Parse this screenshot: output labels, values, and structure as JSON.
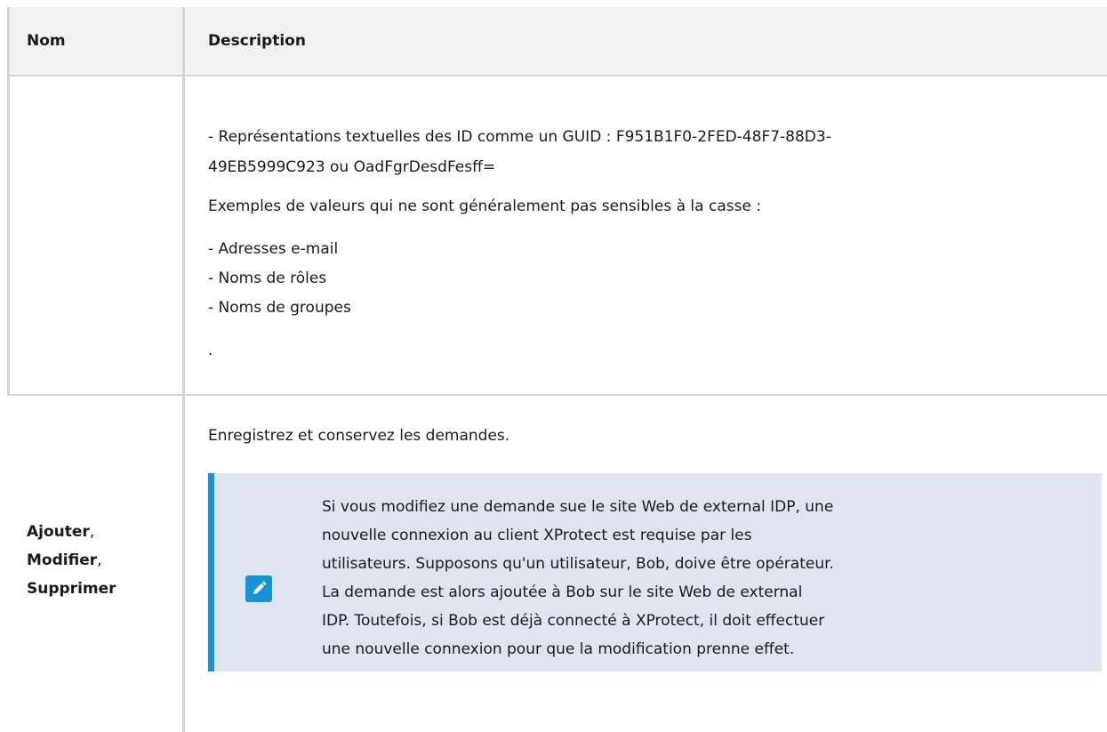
{
  "table": {
    "headers": {
      "name": "Nom",
      "description": "Description"
    },
    "row1": {
      "name": "",
      "lines": [
        "- Représentations textuelles des ID comme un GUID : F951B1F0-2FED-48F7-88D3-",
        "49EB5999C923 ou OadFgrDesdFesff=",
        "Exemples de valeurs qui ne sont généralement pas sensibles à la casse :",
        "- Adresses e-mail",
        "- Noms de rôles",
        "- Noms de groupes",
        "."
      ]
    },
    "row2": {
      "name_parts": {
        "add": "Ajouter",
        "sep1": ",",
        "modify": "Modifier",
        "sep2": ",",
        "delete": "Supprimer"
      },
      "intro": "Enregistrez et conservez les demandes.",
      "note": {
        "icon": "pencil-note-icon",
        "lines": [
          "Si vous modifiez une demande sue le site Web de external IDP, une",
          "nouvelle connexion au client XProtect est requise par les",
          "utilisateurs. Supposons qu'un utilisateur, Bob, doive être opérateur.",
          "La demande est alors ajoutée à Bob sur le site Web de external",
          "IDP. Toutefois, si Bob est déjà connecté à XProtect, il doit effectuer",
          "une nouvelle connexion pour que la modification prenne effet."
        ]
      }
    }
  },
  "colors": {
    "note_bg": "#dfe5f0",
    "note_accent": "#1793d6",
    "header_bg": "#f2f2f2",
    "border": "#d4d4d4"
  }
}
